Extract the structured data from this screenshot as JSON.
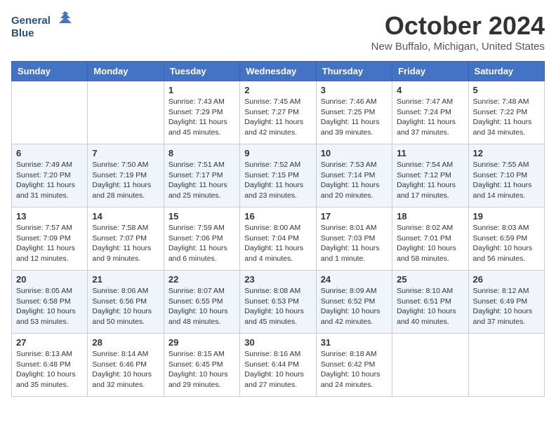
{
  "header": {
    "logo_line1": "General",
    "logo_line2": "Blue",
    "title": "October 2024",
    "subtitle": "New Buffalo, Michigan, United States"
  },
  "weekdays": [
    "Sunday",
    "Monday",
    "Tuesday",
    "Wednesday",
    "Thursday",
    "Friday",
    "Saturday"
  ],
  "weeks": [
    [
      {
        "day": "",
        "sunrise": "",
        "sunset": "",
        "daylight": ""
      },
      {
        "day": "",
        "sunrise": "",
        "sunset": "",
        "daylight": ""
      },
      {
        "day": "1",
        "sunrise": "Sunrise: 7:43 AM",
        "sunset": "Sunset: 7:29 PM",
        "daylight": "Daylight: 11 hours and 45 minutes."
      },
      {
        "day": "2",
        "sunrise": "Sunrise: 7:45 AM",
        "sunset": "Sunset: 7:27 PM",
        "daylight": "Daylight: 11 hours and 42 minutes."
      },
      {
        "day": "3",
        "sunrise": "Sunrise: 7:46 AM",
        "sunset": "Sunset: 7:25 PM",
        "daylight": "Daylight: 11 hours and 39 minutes."
      },
      {
        "day": "4",
        "sunrise": "Sunrise: 7:47 AM",
        "sunset": "Sunset: 7:24 PM",
        "daylight": "Daylight: 11 hours and 37 minutes."
      },
      {
        "day": "5",
        "sunrise": "Sunrise: 7:48 AM",
        "sunset": "Sunset: 7:22 PM",
        "daylight": "Daylight: 11 hours and 34 minutes."
      }
    ],
    [
      {
        "day": "6",
        "sunrise": "Sunrise: 7:49 AM",
        "sunset": "Sunset: 7:20 PM",
        "daylight": "Daylight: 11 hours and 31 minutes."
      },
      {
        "day": "7",
        "sunrise": "Sunrise: 7:50 AM",
        "sunset": "Sunset: 7:19 PM",
        "daylight": "Daylight: 11 hours and 28 minutes."
      },
      {
        "day": "8",
        "sunrise": "Sunrise: 7:51 AM",
        "sunset": "Sunset: 7:17 PM",
        "daylight": "Daylight: 11 hours and 25 minutes."
      },
      {
        "day": "9",
        "sunrise": "Sunrise: 7:52 AM",
        "sunset": "Sunset: 7:15 PM",
        "daylight": "Daylight: 11 hours and 23 minutes."
      },
      {
        "day": "10",
        "sunrise": "Sunrise: 7:53 AM",
        "sunset": "Sunset: 7:14 PM",
        "daylight": "Daylight: 11 hours and 20 minutes."
      },
      {
        "day": "11",
        "sunrise": "Sunrise: 7:54 AM",
        "sunset": "Sunset: 7:12 PM",
        "daylight": "Daylight: 11 hours and 17 minutes."
      },
      {
        "day": "12",
        "sunrise": "Sunrise: 7:55 AM",
        "sunset": "Sunset: 7:10 PM",
        "daylight": "Daylight: 11 hours and 14 minutes."
      }
    ],
    [
      {
        "day": "13",
        "sunrise": "Sunrise: 7:57 AM",
        "sunset": "Sunset: 7:09 PM",
        "daylight": "Daylight: 11 hours and 12 minutes."
      },
      {
        "day": "14",
        "sunrise": "Sunrise: 7:58 AM",
        "sunset": "Sunset: 7:07 PM",
        "daylight": "Daylight: 11 hours and 9 minutes."
      },
      {
        "day": "15",
        "sunrise": "Sunrise: 7:59 AM",
        "sunset": "Sunset: 7:06 PM",
        "daylight": "Daylight: 11 hours and 6 minutes."
      },
      {
        "day": "16",
        "sunrise": "Sunrise: 8:00 AM",
        "sunset": "Sunset: 7:04 PM",
        "daylight": "Daylight: 11 hours and 4 minutes."
      },
      {
        "day": "17",
        "sunrise": "Sunrise: 8:01 AM",
        "sunset": "Sunset: 7:03 PM",
        "daylight": "Daylight: 11 hours and 1 minute."
      },
      {
        "day": "18",
        "sunrise": "Sunrise: 8:02 AM",
        "sunset": "Sunset: 7:01 PM",
        "daylight": "Daylight: 10 hours and 58 minutes."
      },
      {
        "day": "19",
        "sunrise": "Sunrise: 8:03 AM",
        "sunset": "Sunset: 6:59 PM",
        "daylight": "Daylight: 10 hours and 56 minutes."
      }
    ],
    [
      {
        "day": "20",
        "sunrise": "Sunrise: 8:05 AM",
        "sunset": "Sunset: 6:58 PM",
        "daylight": "Daylight: 10 hours and 53 minutes."
      },
      {
        "day": "21",
        "sunrise": "Sunrise: 8:06 AM",
        "sunset": "Sunset: 6:56 PM",
        "daylight": "Daylight: 10 hours and 50 minutes."
      },
      {
        "day": "22",
        "sunrise": "Sunrise: 8:07 AM",
        "sunset": "Sunset: 6:55 PM",
        "daylight": "Daylight: 10 hours and 48 minutes."
      },
      {
        "day": "23",
        "sunrise": "Sunrise: 8:08 AM",
        "sunset": "Sunset: 6:53 PM",
        "daylight": "Daylight: 10 hours and 45 minutes."
      },
      {
        "day": "24",
        "sunrise": "Sunrise: 8:09 AM",
        "sunset": "Sunset: 6:52 PM",
        "daylight": "Daylight: 10 hours and 42 minutes."
      },
      {
        "day": "25",
        "sunrise": "Sunrise: 8:10 AM",
        "sunset": "Sunset: 6:51 PM",
        "daylight": "Daylight: 10 hours and 40 minutes."
      },
      {
        "day": "26",
        "sunrise": "Sunrise: 8:12 AM",
        "sunset": "Sunset: 6:49 PM",
        "daylight": "Daylight: 10 hours and 37 minutes."
      }
    ],
    [
      {
        "day": "27",
        "sunrise": "Sunrise: 8:13 AM",
        "sunset": "Sunset: 6:48 PM",
        "daylight": "Daylight: 10 hours and 35 minutes."
      },
      {
        "day": "28",
        "sunrise": "Sunrise: 8:14 AM",
        "sunset": "Sunset: 6:46 PM",
        "daylight": "Daylight: 10 hours and 32 minutes."
      },
      {
        "day": "29",
        "sunrise": "Sunrise: 8:15 AM",
        "sunset": "Sunset: 6:45 PM",
        "daylight": "Daylight: 10 hours and 29 minutes."
      },
      {
        "day": "30",
        "sunrise": "Sunrise: 8:16 AM",
        "sunset": "Sunset: 6:44 PM",
        "daylight": "Daylight: 10 hours and 27 minutes."
      },
      {
        "day": "31",
        "sunrise": "Sunrise: 8:18 AM",
        "sunset": "Sunset: 6:42 PM",
        "daylight": "Daylight: 10 hours and 24 minutes."
      },
      {
        "day": "",
        "sunrise": "",
        "sunset": "",
        "daylight": ""
      },
      {
        "day": "",
        "sunrise": "",
        "sunset": "",
        "daylight": ""
      }
    ]
  ]
}
